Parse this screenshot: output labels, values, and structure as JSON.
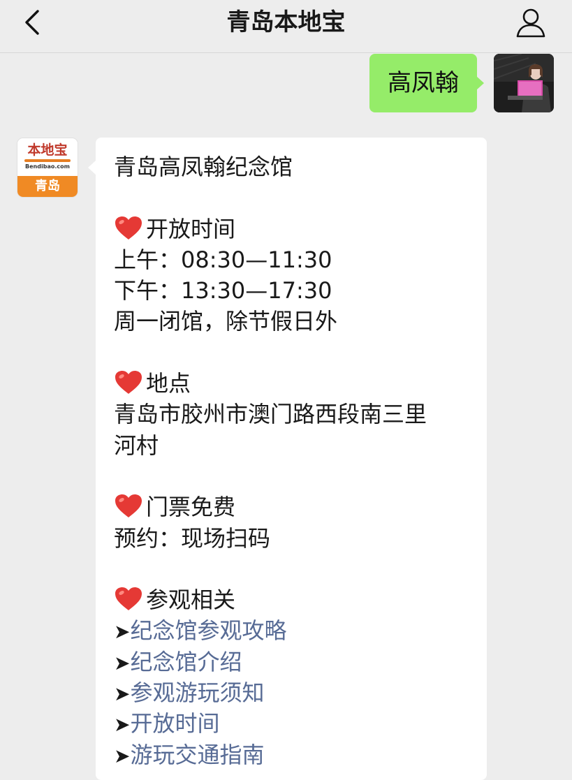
{
  "nav": {
    "title": "青岛本地宝"
  },
  "outgoing_message": {
    "text": "高凤翰"
  },
  "bot": {
    "logo_text": "本地宝",
    "logo_domain": "Bendibao.com",
    "city": "青岛"
  },
  "reply": {
    "title": "青岛高凤翰纪念馆",
    "hours": {
      "heading": "开放时间",
      "morning": "上午：08:30—11:30",
      "afternoon": "下午：13:30—17:30",
      "note": "周一闭馆，除节假日外"
    },
    "location": {
      "heading": "地点",
      "address_line1": "青岛市胶州市澳门路西段南三里",
      "address_line2": "河村"
    },
    "ticket": {
      "heading": "门票免费",
      "reservation": "预约：现场扫码"
    },
    "visit": {
      "heading": "参观相关",
      "arrow": "➤",
      "links": [
        "纪念馆参观攻略",
        "纪念馆介绍",
        "参观游玩须知",
        "开放时间",
        "游玩交通指南"
      ]
    }
  },
  "colors": {
    "background": "#ededed",
    "outgoing_bubble": "#95ec69",
    "link": "#576b95",
    "heart": "#e53935"
  }
}
